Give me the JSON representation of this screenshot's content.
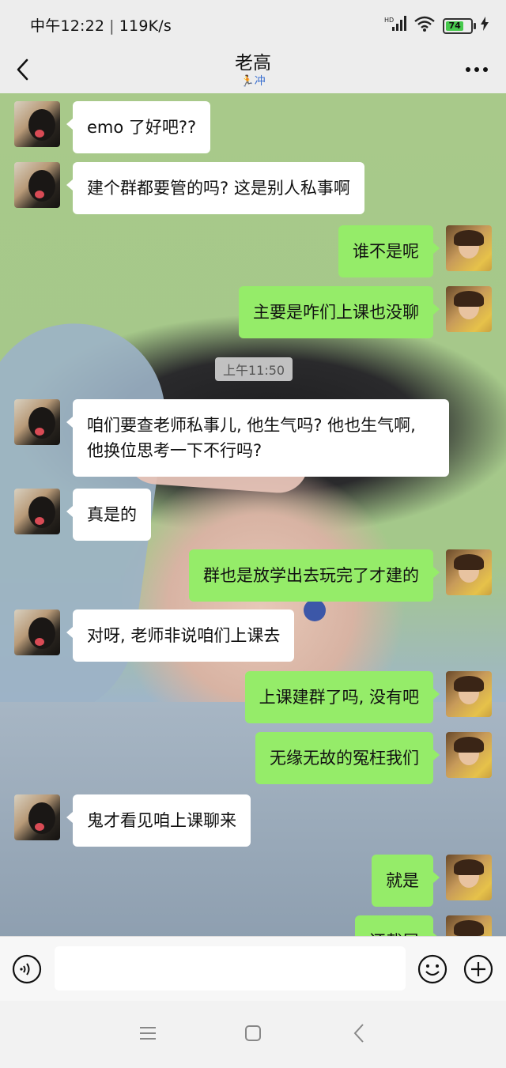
{
  "status_bar": {
    "time": "中午12:22",
    "net_speed": "119K/s",
    "signal_label": "HD",
    "battery_level": "74",
    "battery_fraction": 0.74
  },
  "header": {
    "title": "老高",
    "subtitle": "🏃冲"
  },
  "messages": [
    {
      "side": "left",
      "avatar": "dog-avatar",
      "text": "emo 了好吧??"
    },
    {
      "side": "left",
      "avatar": "dog-avatar",
      "text": "建个群都要管的吗? 这是别人私事啊"
    },
    {
      "side": "right",
      "avatar": "girl-avatar",
      "text": "谁不是呢"
    },
    {
      "side": "right",
      "avatar": "girl-avatar",
      "text": "主要是咋们上课也没聊"
    },
    {
      "side": "left",
      "avatar": "dog-avatar",
      "text": "咱们要查老师私事儿, 他生气吗? 他也生气啊, 他换位思考一下不行吗?"
    },
    {
      "side": "left",
      "avatar": "dog-avatar",
      "text": "真是的"
    },
    {
      "side": "right",
      "avatar": "girl-avatar",
      "text": "群也是放学出去玩完了才建的"
    },
    {
      "side": "left",
      "avatar": "dog-avatar",
      "text": "对呀, 老师非说咱们上课去"
    },
    {
      "side": "right",
      "avatar": "girl-avatar",
      "text": "上课建群了吗, 没有吧"
    },
    {
      "side": "right",
      "avatar": "girl-avatar",
      "text": "无缘无故的冤枉我们"
    },
    {
      "side": "left",
      "avatar": "dog-avatar",
      "text": "鬼才看见咱上课聊来"
    },
    {
      "side": "right",
      "avatar": "girl-avatar",
      "text": "就是"
    },
    {
      "side": "right",
      "avatar": "girl-avatar",
      "text": "还截屏"
    }
  ],
  "timestamp": "上午11:50",
  "input": {
    "value": "",
    "placeholder": ""
  },
  "icons": {
    "voice": "voice-icon",
    "emoji": "emoji-icon",
    "plus": "plus-icon",
    "more": "more-icon",
    "back": "back-icon"
  },
  "colors": {
    "sent_bubble": "#95ec69",
    "received_bubble": "#ffffff",
    "background_green": "#a8c98a"
  }
}
